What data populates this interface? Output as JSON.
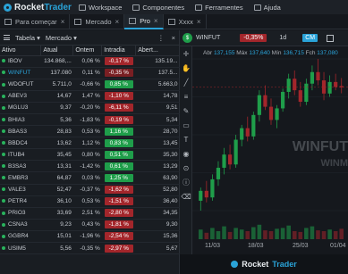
{
  "app": {
    "brand_rocket": "Rocket",
    "brand_trader": "Trader"
  },
  "menu": [
    {
      "label": "Workspace"
    },
    {
      "label": "Componentes"
    },
    {
      "label": "Ferramentes"
    },
    {
      "label": "Ajuda"
    }
  ],
  "tabs": [
    {
      "label": "Para começar"
    },
    {
      "label": "Mercado"
    },
    {
      "label": "Pro"
    },
    {
      "label": "Xxxx"
    }
  ],
  "table_panel": {
    "view_label": "Tabela",
    "market_label": "Mercado",
    "columns": [
      "Ativo",
      "Atual",
      "Ontem",
      "Intradia",
      "Abert..."
    ],
    "rows": [
      {
        "ativo": "IBOV",
        "atual": "134.868,...",
        "ontem": "0,06 %",
        "intradia": "-0,17 %",
        "abert": "135.19...",
        "tone": "neg"
      },
      {
        "ativo": "WINFUT",
        "atual": "137.080",
        "ontem": "0,11 %",
        "intradia": "-0,35 %",
        "abert": "137.5...",
        "tone": "negd"
      },
      {
        "ativo": "WDOFUT",
        "atual": "5.711,0",
        "ontem": "-0,66 %",
        "intradia": "0,85 %",
        "abert": "5.663,0",
        "tone": "pos"
      },
      {
        "ativo": "ABEV3",
        "atual": "14,67",
        "ontem": "1,47 %",
        "intradia": "-1,10 %",
        "abert": "14,78",
        "tone": "neg"
      },
      {
        "ativo": "MGLU3",
        "atual": "9,37",
        "ontem": "-0,20 %",
        "intradia": "-6,11 %",
        "abert": "9,51",
        "tone": "neg"
      },
      {
        "ativo": "BHIA3",
        "atual": "5,36",
        "ontem": "-1,83 %",
        "intradia": "-0,19 %",
        "abert": "5,34",
        "tone": "neg"
      },
      {
        "ativo": "BBAS3",
        "atual": "28,83",
        "ontem": "0,53 %",
        "intradia": "1,16 %",
        "abert": "28,70",
        "tone": "pos"
      },
      {
        "ativo": "BBDC4",
        "atual": "13,62",
        "ontem": "1,12 %",
        "intradia": "0,83 %",
        "abert": "13,45",
        "tone": "pos"
      },
      {
        "ativo": "ITUB4",
        "atual": "35,45",
        "ontem": "0,80 %",
        "intradia": "0,51 %",
        "abert": "35,30",
        "tone": "pos"
      },
      {
        "ativo": "B3SA3",
        "atual": "13,31",
        "ontem": "-1,42 %",
        "intradia": "0,61 %",
        "abert": "13,29",
        "tone": "pos"
      },
      {
        "ativo": "EMBR3",
        "atual": "64,87",
        "ontem": "0,03 %",
        "intradia": "1,25 %",
        "abert": "63,90",
        "tone": "pos"
      },
      {
        "ativo": "VALE3",
        "atual": "52,47",
        "ontem": "-0,37 %",
        "intradia": "-1,62 %",
        "abert": "52,80",
        "tone": "neg"
      },
      {
        "ativo": "PETR4",
        "atual": "36,10",
        "ontem": "0,53 %",
        "intradia": "-1,51 %",
        "abert": "36,40",
        "tone": "neg"
      },
      {
        "ativo": "PRIO3",
        "atual": "33,69",
        "ontem": "2,51 %",
        "intradia": "-2,80 %",
        "abert": "34,35",
        "tone": "neg"
      },
      {
        "ativo": "CSNA3",
        "atual": "9,23",
        "ontem": "0,43 %",
        "intradia": "-1,81 %",
        "abert": "9,30",
        "tone": "neg"
      },
      {
        "ativo": "GGBR4",
        "atual": "15,01",
        "ontem": "-1,96 %",
        "intradia": "-2,54 %",
        "abert": "15,36",
        "tone": "neg"
      },
      {
        "ativo": "USIM5",
        "atual": "5,56",
        "ontem": "-0,35 %",
        "intradia": "-2,97 %",
        "abert": "5,67",
        "tone": "neg"
      }
    ]
  },
  "chart_panel": {
    "symbol": "WINFUT",
    "change": "-0,35%",
    "timeframe": "1d",
    "mode_button": "CM",
    "stats": {
      "abr_label": "Abr",
      "abr": "137,155",
      "max_label": "Máx",
      "max": "137,640",
      "min_label": "Mín",
      "min": "136,715",
      "fch_label": "Fch",
      "fch": "137,080"
    },
    "watermark": "WINFUT",
    "watermark2": "WINM",
    "x_labels": [
      "11/03",
      "18/03",
      "25/03",
      "01/04"
    ],
    "footer_rocket": "Rocket",
    "footer_trader": "Trader",
    "colors": {
      "up": "#1f9e4a",
      "down": "#a3262b",
      "accent": "#2aa3d8"
    },
    "candles": [
      {
        "o": 130.2,
        "h": 131.0,
        "l": 129.6,
        "c": 130.8
      },
      {
        "o": 130.8,
        "h": 131.4,
        "l": 130.1,
        "c": 130.4
      },
      {
        "o": 130.4,
        "h": 131.8,
        "l": 130.2,
        "c": 131.5
      },
      {
        "o": 131.5,
        "h": 132.6,
        "l": 131.1,
        "c": 132.2
      },
      {
        "o": 132.2,
        "h": 133.4,
        "l": 131.8,
        "c": 133.0
      },
      {
        "o": 133.0,
        "h": 133.6,
        "l": 132.1,
        "c": 132.4
      },
      {
        "o": 132.4,
        "h": 134.2,
        "l": 132.2,
        "c": 133.9
      },
      {
        "o": 133.9,
        "h": 134.8,
        "l": 133.5,
        "c": 134.6
      },
      {
        "o": 134.6,
        "h": 135.3,
        "l": 133.8,
        "c": 134.1
      },
      {
        "o": 134.1,
        "h": 135.6,
        "l": 133.9,
        "c": 135.4
      },
      {
        "o": 135.4,
        "h": 136.9,
        "l": 135.0,
        "c": 136.6
      },
      {
        "o": 136.6,
        "h": 137.2,
        "l": 135.7,
        "c": 135.9
      },
      {
        "o": 135.9,
        "h": 136.4,
        "l": 134.8,
        "c": 135.1
      },
      {
        "o": 135.1,
        "h": 136.0,
        "l": 134.6,
        "c": 135.8
      },
      {
        "o": 135.8,
        "h": 137.0,
        "l": 135.6,
        "c": 136.8
      },
      {
        "o": 136.8,
        "h": 137.9,
        "l": 136.4,
        "c": 137.6
      },
      {
        "o": 137.6,
        "h": 138.1,
        "l": 136.6,
        "c": 136.9
      },
      {
        "o": 136.9,
        "h": 137.4,
        "l": 135.9,
        "c": 136.2
      },
      {
        "o": 136.2,
        "h": 137.6,
        "l": 136.0,
        "c": 137.3
      },
      {
        "o": 137.3,
        "h": 138.4,
        "l": 136.9,
        "c": 138.0
      },
      {
        "o": 138.0,
        "h": 138.8,
        "l": 137.2,
        "c": 137.5
      },
      {
        "o": 137.5,
        "h": 138.0,
        "l": 136.3,
        "c": 136.7
      },
      {
        "o": 136.7,
        "h": 137.8,
        "l": 136.5,
        "c": 137.4
      },
      {
        "o": 137.4,
        "h": 137.9,
        "l": 136.9,
        "c": 137.1
      },
      {
        "o": 137.155,
        "h": 137.64,
        "l": 136.715,
        "c": 137.08
      }
    ],
    "volumes": [
      0.6,
      0.4,
      0.7,
      0.5,
      0.8,
      0.45,
      0.7,
      0.6,
      0.5,
      0.75,
      0.9,
      0.55,
      0.5,
      0.65,
      0.7,
      0.85,
      0.5,
      0.45,
      0.7,
      0.8,
      0.55,
      0.5,
      0.6,
      0.5,
      0.65
    ]
  }
}
